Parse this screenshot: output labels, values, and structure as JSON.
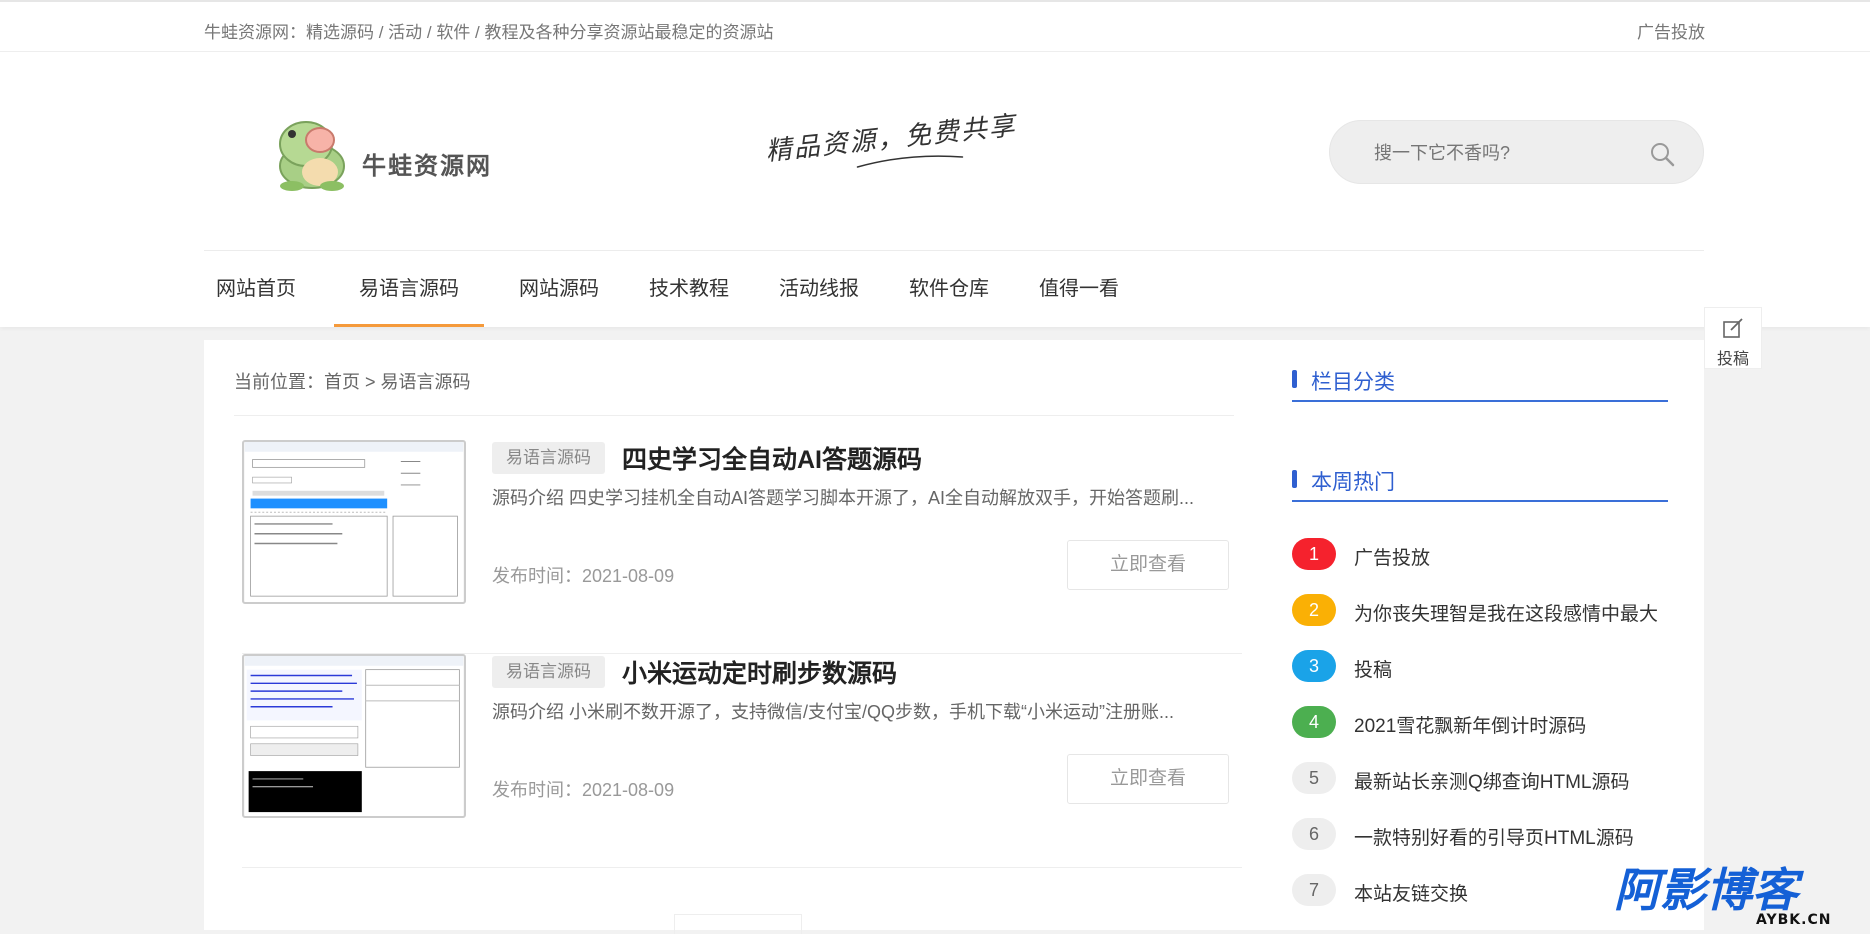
{
  "topbar": {
    "tagline": "牛蛙资源网：精选源码 / 活动 / 软件 / 教程及各种分享资源站最稳定的资源站",
    "ad_link": "广告投放"
  },
  "header": {
    "logo_text": "牛蛙资源网",
    "slogan": "精品资源，免费共享",
    "search_placeholder": "搜一下它不香吗?"
  },
  "nav": {
    "items": [
      {
        "label": "网站首页",
        "active": false
      },
      {
        "label": "易语言源码",
        "active": true
      },
      {
        "label": "网站源码",
        "active": false
      },
      {
        "label": "技术教程",
        "active": false
      },
      {
        "label": "活动线报",
        "active": false
      },
      {
        "label": "软件仓库",
        "active": false
      },
      {
        "label": "值得一看",
        "active": false
      }
    ]
  },
  "float_button": {
    "label": "投稿"
  },
  "breadcrumb": {
    "prefix": "当前位置：",
    "home": "首页",
    "sep": ">",
    "current": "易语言源码"
  },
  "posts": [
    {
      "tag": "易语言源码",
      "title": "四史学习全自动AI答题源码",
      "summary": "源码介绍 四史学习挂机全自动AI答题学习脚本开源了，AI全自动解放双手，开始答题刷...",
      "date": "发布时间：2021-08-09",
      "button": "立即查看"
    },
    {
      "tag": "易语言源码",
      "title": "小米运动定时刷步数源码",
      "summary": "源码介绍 小米刷不数开源了，支持微信/支付宝/QQ步数，手机下载“小米运动”注册账...",
      "date": "发布时间：2021-08-09",
      "button": "立即查看"
    }
  ],
  "sidebar": {
    "category_title": "栏目分类",
    "hot_title": "本周热门",
    "hot_items": [
      {
        "num": "1",
        "text": "广告投放",
        "color": "#f5222d"
      },
      {
        "num": "2",
        "text": "为你丧失理智是我在这段感情中最大",
        "color": "#fab005"
      },
      {
        "num": "3",
        "text": "投稿",
        "color": "#1aa3e8"
      },
      {
        "num": "4",
        "text": "2021雪花飘新年倒计时源码",
        "color": "#4caf50"
      },
      {
        "num": "5",
        "text": "最新站长亲测Q绑查询HTML源码",
        "color": "#eeeeee"
      },
      {
        "num": "6",
        "text": "一款特别好看的引导页HTML源码",
        "color": "#eeeeee"
      },
      {
        "num": "7",
        "text": "本站友链交换",
        "color": "#eeeeee"
      }
    ]
  },
  "watermark": {
    "line1": "阿影博客",
    "line2": "AYBK.CN"
  },
  "colors": {
    "accent": "#2f5fd0",
    "nav_active": "#f59a3b"
  }
}
